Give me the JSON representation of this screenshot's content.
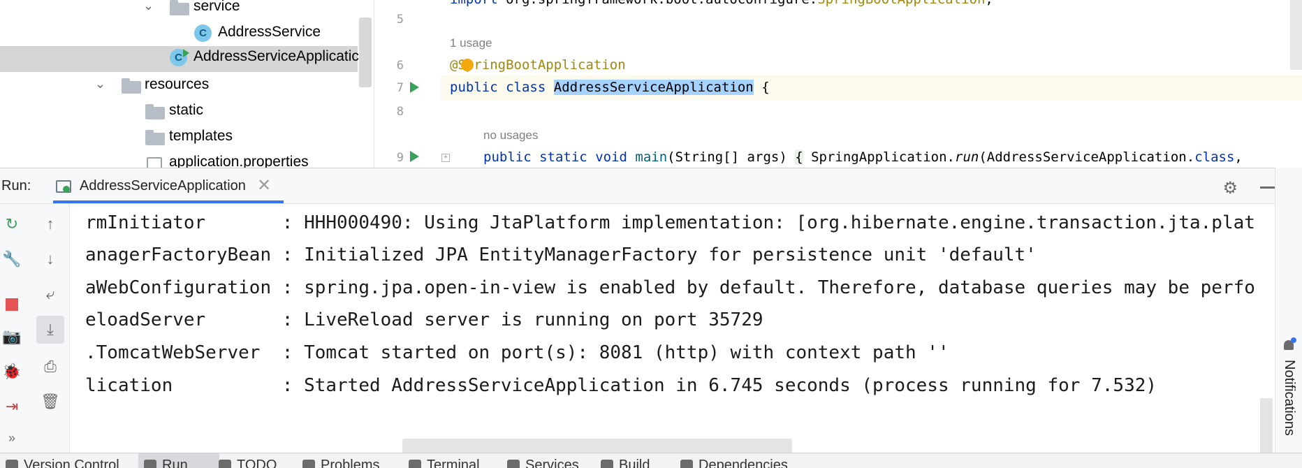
{
  "project_tree": {
    "items": [
      {
        "label": "service",
        "kind": "folder",
        "expanded": true
      },
      {
        "label": "AddressService",
        "kind": "class"
      },
      {
        "label": "AddressServiceApplicatic",
        "kind": "run-class",
        "selected": true
      },
      {
        "label": "resources",
        "kind": "folder",
        "expanded": true
      },
      {
        "label": "static",
        "kind": "folder"
      },
      {
        "label": "templates",
        "kind": "folder"
      },
      {
        "label": "application.properties",
        "kind": "properties"
      }
    ]
  },
  "editor": {
    "lines": {
      "l4": {
        "number": "",
        "text_import": "import",
        "text_rest": " org.springframework.boot.autoconfigure.",
        "text_ann": "SpringBootApplication",
        "text_end": ";"
      },
      "l5": {
        "number": "5"
      },
      "usage_hint": "1 usage",
      "l6": {
        "number": "6",
        "annotation": "@SpringBootApplication"
      },
      "l7": {
        "number": "7",
        "kw1": "public",
        "kw2": "class",
        "class_name": "AddressServiceApplication",
        "brace": "{"
      },
      "l8": {
        "number": "8"
      },
      "no_usages_hint": "no usages",
      "l9": {
        "number": "9",
        "kw1": "public",
        "kw2": "static",
        "kw3": "void",
        "method": "main",
        "params": "(String[] args) ",
        "brace": "{",
        "body_cls": " SpringApplication.",
        "body_call": "run",
        "body_args": "(AddressServiceApplication.",
        "body_kw": "class",
        "body_end": ","
      }
    }
  },
  "run_panel": {
    "label": "Run:",
    "tab_title": "AddressServiceApplication",
    "close_glyph": "✕",
    "settings_glyph": "⚙",
    "tools": {
      "rerun": "↻",
      "up": "↑",
      "wrench": "🔧",
      "down": "↓",
      "wrap": "⤶",
      "camera": "📷",
      "scroll_end": "⤓",
      "bug": "🐞",
      "print": "⎙",
      "exit": "⇥",
      "trash": "🗑",
      "more": "»"
    },
    "console_lines": [
      "rmInitiator       : HHH000490: Using JtaPlatform implementation: [org.hibernate.engine.transaction.jta.plat",
      "anagerFactoryBean : Initialized JPA EntityManagerFactory for persistence unit 'default'",
      "aWebConfiguration : spring.jpa.open-in-view is enabled by default. Therefore, database queries may be perfo",
      "eloadServer       : LiveReload server is running on port 35729",
      ".TomcatWebServer  : Tomcat started on port(s): 8081 (http) with context path ''",
      "lication          : Started AddressServiceApplication in 6.745 seconds (process running for 7.532)"
    ]
  },
  "right_strip": {
    "notifications_label": "Notifications"
  },
  "bottom_bar": {
    "items": [
      {
        "label": "Version Control"
      },
      {
        "label": "Run",
        "active": true
      },
      {
        "label": "TODO"
      },
      {
        "label": "Problems"
      },
      {
        "label": "Terminal"
      },
      {
        "label": "Services"
      },
      {
        "label": "Build"
      },
      {
        "label": "Dependencies"
      }
    ]
  },
  "colors": {
    "accent": "#3574f0",
    "run_green": "#3aa15a",
    "stop_red": "#e55454",
    "keyword": "#0033b3",
    "annotation": "#9e880d",
    "selection": "#a6d2ff"
  }
}
